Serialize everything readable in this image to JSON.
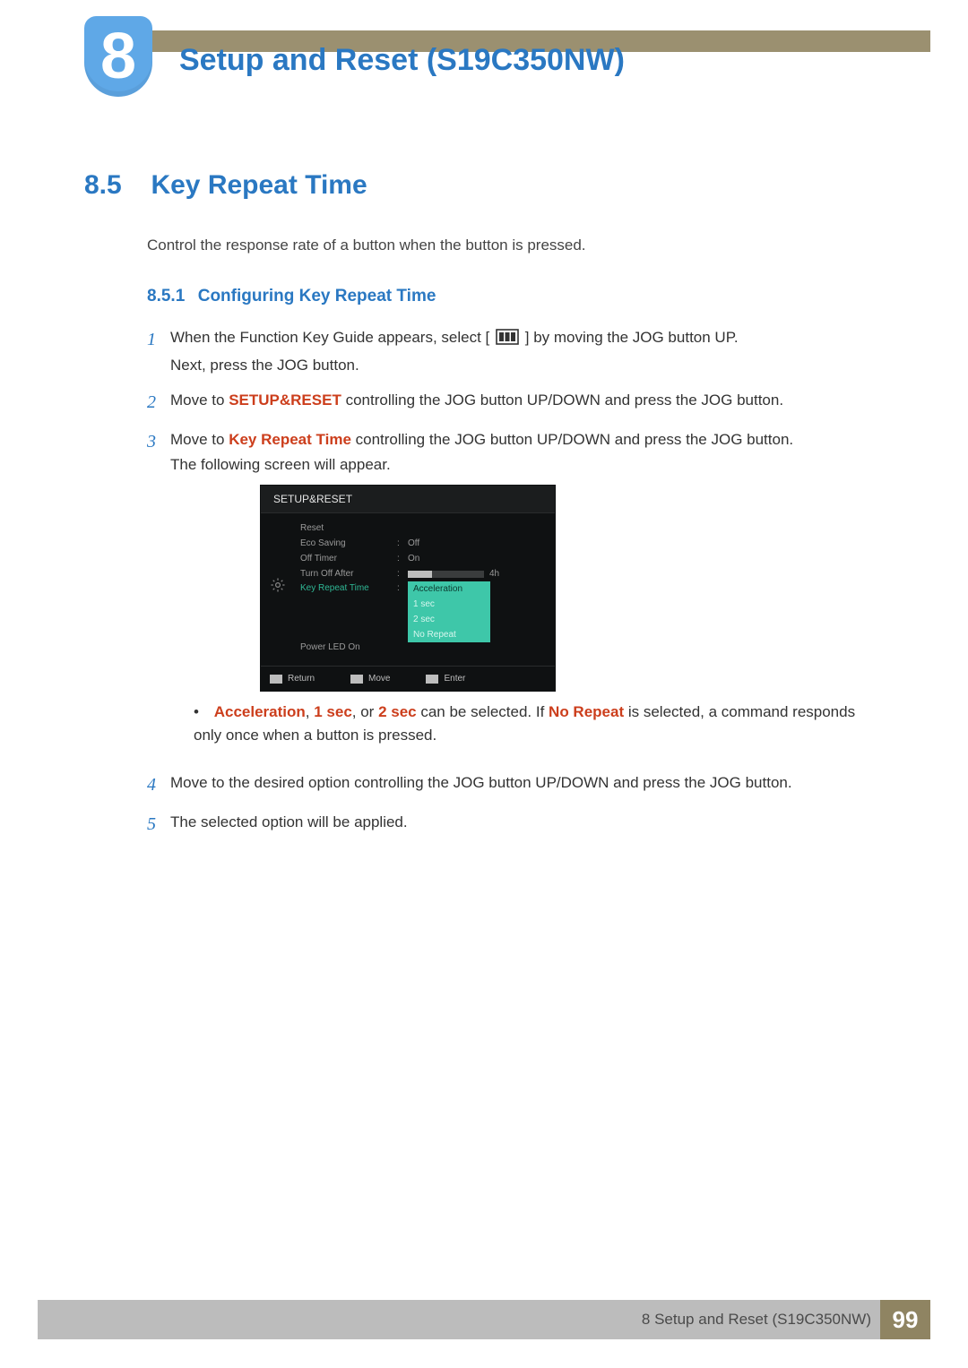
{
  "header": {
    "chapter_number": "8",
    "chapter_title": "Setup and Reset (S19C350NW)"
  },
  "section": {
    "number": "8.5",
    "title": "Key Repeat Time",
    "intro": "Control the response rate of a button when the button is pressed."
  },
  "subsection": {
    "number": "8.5.1",
    "title": "Configuring Key Repeat Time"
  },
  "steps": {
    "s1a": "When the Function Key Guide appears, select",
    "s1b": "by moving the JOG button UP.",
    "s1c": "Next, press the JOG button.",
    "s2a": "Move to ",
    "s2_bold": "SETUP&RESET",
    "s2b": " controlling the JOG button UP/DOWN and press the JOG button.",
    "s3a": "Move to ",
    "s3_bold": "Key Repeat Time",
    "s3b": " controlling the JOG button UP/DOWN and press the JOG button.",
    "s3c": "The following screen will appear.",
    "bullet_a1": "Acceleration",
    "bullet_sep1": ", ",
    "bullet_a2": "1 sec",
    "bullet_sep2": ", or  ",
    "bullet_a3": "2 sec",
    "bullet_b": " can be selected. If ",
    "bullet_a4": "No Repeat",
    "bullet_c": " is selected, a command responds only once when a button is pressed.",
    "s4": "Move to the desired option controlling the JOG button UP/DOWN and press the JOG button.",
    "s5": "The selected option will be applied."
  },
  "osd": {
    "title": "SETUP&RESET",
    "rows": {
      "reset": "Reset",
      "eco": "Eco Saving",
      "eco_val": "Off",
      "off_timer": "Off Timer",
      "off_timer_val": "On",
      "turn_off": "Turn Off After",
      "turn_off_val": "4h",
      "krt": "Key Repeat Time",
      "power_led": "Power LED On"
    },
    "dropdown": {
      "opt1": "Acceleration",
      "opt2": "1 sec",
      "opt3": "2 sec",
      "opt4": "No Repeat"
    },
    "footer": {
      "return": "Return",
      "move": "Move",
      "enter": "Enter"
    }
  },
  "step_numbers": {
    "n1": "1",
    "n2": "2",
    "n3": "3",
    "n4": "4",
    "n5": "5"
  },
  "footer": {
    "text": "8 Setup and Reset (S19C350NW)",
    "page": "99"
  }
}
